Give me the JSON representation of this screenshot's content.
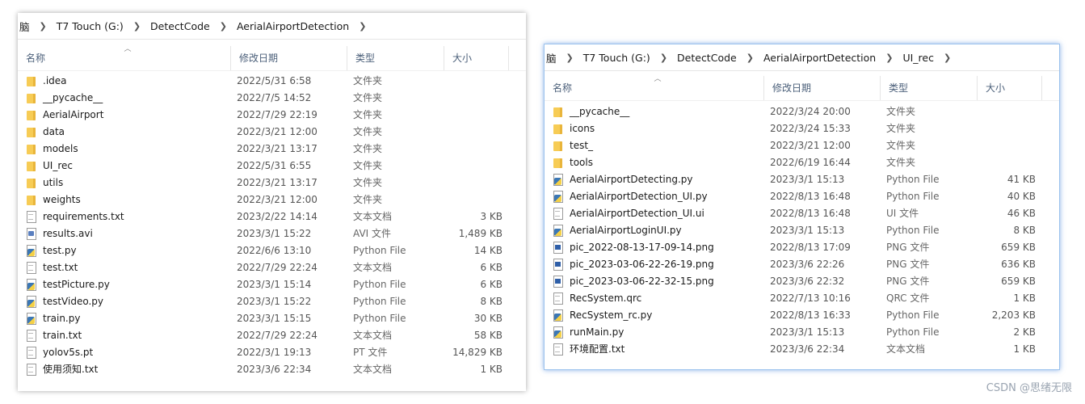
{
  "left": {
    "breadcrumb": [
      "脑",
      "T7 Touch (G:)",
      "DetectCode",
      "AerialAirportDetection"
    ],
    "columns": {
      "name": "名称",
      "date": "修改日期",
      "type": "类型",
      "size": "大小"
    },
    "files": [
      {
        "icon": "folder",
        "name": ".idea",
        "date": "2022/5/31 6:58",
        "type": "文件夹",
        "size": ""
      },
      {
        "icon": "folder",
        "name": "__pycache__",
        "date": "2022/7/5 14:52",
        "type": "文件夹",
        "size": ""
      },
      {
        "icon": "folder",
        "name": "AerialAirport",
        "date": "2022/7/29 22:19",
        "type": "文件夹",
        "size": ""
      },
      {
        "icon": "folder",
        "name": "data",
        "date": "2022/3/21 12:00",
        "type": "文件夹",
        "size": ""
      },
      {
        "icon": "folder",
        "name": "models",
        "date": "2022/3/21 13:17",
        "type": "文件夹",
        "size": ""
      },
      {
        "icon": "folder",
        "name": "UI_rec",
        "date": "2022/5/31 6:55",
        "type": "文件夹",
        "size": ""
      },
      {
        "icon": "folder",
        "name": "utils",
        "date": "2022/3/21 13:17",
        "type": "文件夹",
        "size": ""
      },
      {
        "icon": "folder",
        "name": "weights",
        "date": "2022/3/21 12:00",
        "type": "文件夹",
        "size": ""
      },
      {
        "icon": "file",
        "name": "requirements.txt",
        "date": "2023/2/22 14:14",
        "type": "文本文档",
        "size": "3 KB"
      },
      {
        "icon": "video",
        "name": "results.avi",
        "date": "2023/3/1 15:22",
        "type": "AVI 文件",
        "size": "1,489 KB"
      },
      {
        "icon": "py",
        "name": "test.py",
        "date": "2022/6/6 13:10",
        "type": "Python File",
        "size": "14 KB"
      },
      {
        "icon": "file",
        "name": "test.txt",
        "date": "2022/7/29 22:24",
        "type": "文本文档",
        "size": "6 KB"
      },
      {
        "icon": "py",
        "name": "testPicture.py",
        "date": "2023/3/1 15:14",
        "type": "Python File",
        "size": "6 KB"
      },
      {
        "icon": "py",
        "name": "testVideo.py",
        "date": "2023/3/1 15:22",
        "type": "Python File",
        "size": "8 KB"
      },
      {
        "icon": "py",
        "name": "train.py",
        "date": "2023/3/1 15:15",
        "type": "Python File",
        "size": "30 KB"
      },
      {
        "icon": "file",
        "name": "train.txt",
        "date": "2022/7/29 22:24",
        "type": "文本文档",
        "size": "58 KB"
      },
      {
        "icon": "file",
        "name": "yolov5s.pt",
        "date": "2022/3/1 19:13",
        "type": "PT 文件",
        "size": "14,829 KB"
      },
      {
        "icon": "file",
        "name": "使用须知.txt",
        "date": "2023/3/6 22:34",
        "type": "文本文档",
        "size": "1 KB"
      }
    ]
  },
  "right": {
    "breadcrumb": [
      "脑",
      "T7 Touch (G:)",
      "DetectCode",
      "AerialAirportDetection",
      "UI_rec"
    ],
    "columns": {
      "name": "名称",
      "date": "修改日期",
      "type": "类型",
      "size": "大小"
    },
    "files": [
      {
        "icon": "folder",
        "name": "__pycache__",
        "date": "2022/3/24 20:00",
        "type": "文件夹",
        "size": ""
      },
      {
        "icon": "folder",
        "name": "icons",
        "date": "2022/3/24 15:33",
        "type": "文件夹",
        "size": ""
      },
      {
        "icon": "folder",
        "name": "test_",
        "date": "2022/3/21 12:00",
        "type": "文件夹",
        "size": ""
      },
      {
        "icon": "folder",
        "name": "tools",
        "date": "2022/6/19 16:44",
        "type": "文件夹",
        "size": ""
      },
      {
        "icon": "py",
        "name": "AerialAirportDetecting.py",
        "date": "2023/3/1 15:13",
        "type": "Python File",
        "size": "41 KB"
      },
      {
        "icon": "py",
        "name": "AerialAirportDetection_UI.py",
        "date": "2022/8/13 16:48",
        "type": "Python File",
        "size": "40 KB"
      },
      {
        "icon": "file",
        "name": "AerialAirportDetection_UI.ui",
        "date": "2022/8/13 16:48",
        "type": "UI 文件",
        "size": "46 KB"
      },
      {
        "icon": "py",
        "name": "AerialAirportLoginUI.py",
        "date": "2023/3/1 15:13",
        "type": "Python File",
        "size": "8 KB"
      },
      {
        "icon": "img",
        "name": "pic_2022-08-13-17-09-14.png",
        "date": "2022/8/13 17:09",
        "type": "PNG 文件",
        "size": "659 KB"
      },
      {
        "icon": "img",
        "name": "pic_2023-03-06-22-26-19.png",
        "date": "2023/3/6 22:26",
        "type": "PNG 文件",
        "size": "636 KB"
      },
      {
        "icon": "img",
        "name": "pic_2023-03-06-22-32-15.png",
        "date": "2023/3/6 22:32",
        "type": "PNG 文件",
        "size": "659 KB"
      },
      {
        "icon": "file",
        "name": "RecSystem.qrc",
        "date": "2022/7/13 10:16",
        "type": "QRC 文件",
        "size": "1 KB"
      },
      {
        "icon": "py",
        "name": "RecSystem_rc.py",
        "date": "2022/8/13 16:33",
        "type": "Python File",
        "size": "2,203 KB"
      },
      {
        "icon": "py",
        "name": "runMain.py",
        "date": "2023/3/1 15:13",
        "type": "Python File",
        "size": "2 KB"
      },
      {
        "icon": "file",
        "name": "环境配置.txt",
        "date": "2023/3/6 22:34",
        "type": "文本文档",
        "size": "1 KB"
      }
    ]
  },
  "watermark": "CSDN @思绪无限"
}
